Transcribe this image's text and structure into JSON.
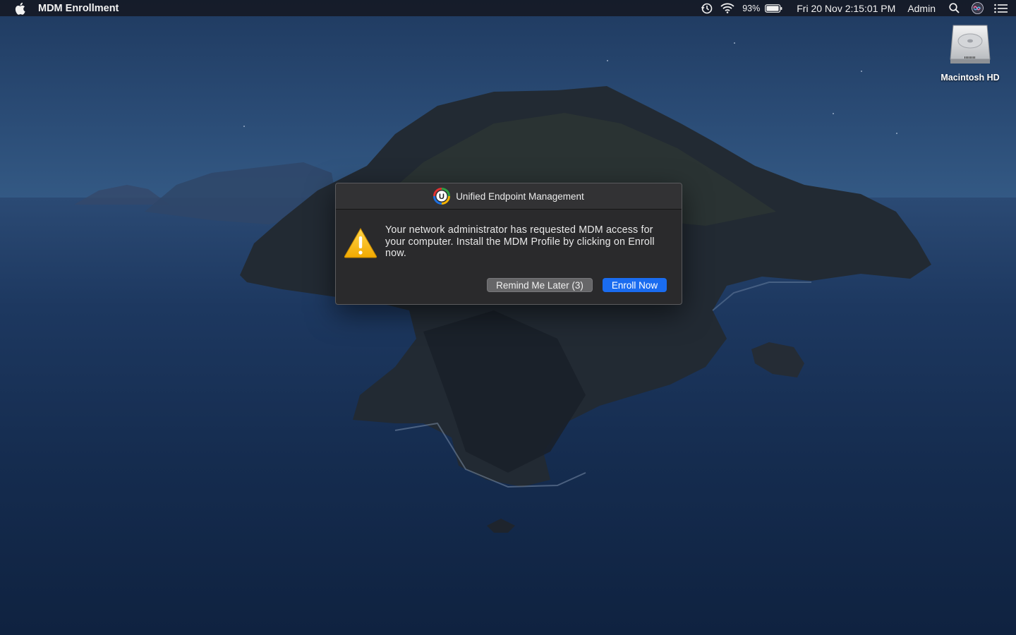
{
  "menubar": {
    "app_name": "MDM Enrollment",
    "icons": [
      "apple-logo-icon",
      "time-machine-icon",
      "wifi-icon",
      "battery-icon",
      "search-icon",
      "siri-icon",
      "notification-center-icon"
    ],
    "battery_percent": "93%",
    "datetime": "Fri 20 Nov  2:15:01 PM",
    "user": "Admin"
  },
  "desktop": {
    "drive_label": "Macintosh HD",
    "drive_icon": "hard-drive-icon"
  },
  "dialog": {
    "title": "Unified Endpoint Management",
    "logo_icon": "uem-logo-icon",
    "alert_icon": "warning-icon",
    "message": "Your network administrator has requested MDM access for your computer. Install the MDM Profile by clicking on Enroll now.",
    "remind_label": "Remind Me Later (3)",
    "enroll_label": "Enroll Now",
    "accent_color": "#1a6cf0"
  }
}
